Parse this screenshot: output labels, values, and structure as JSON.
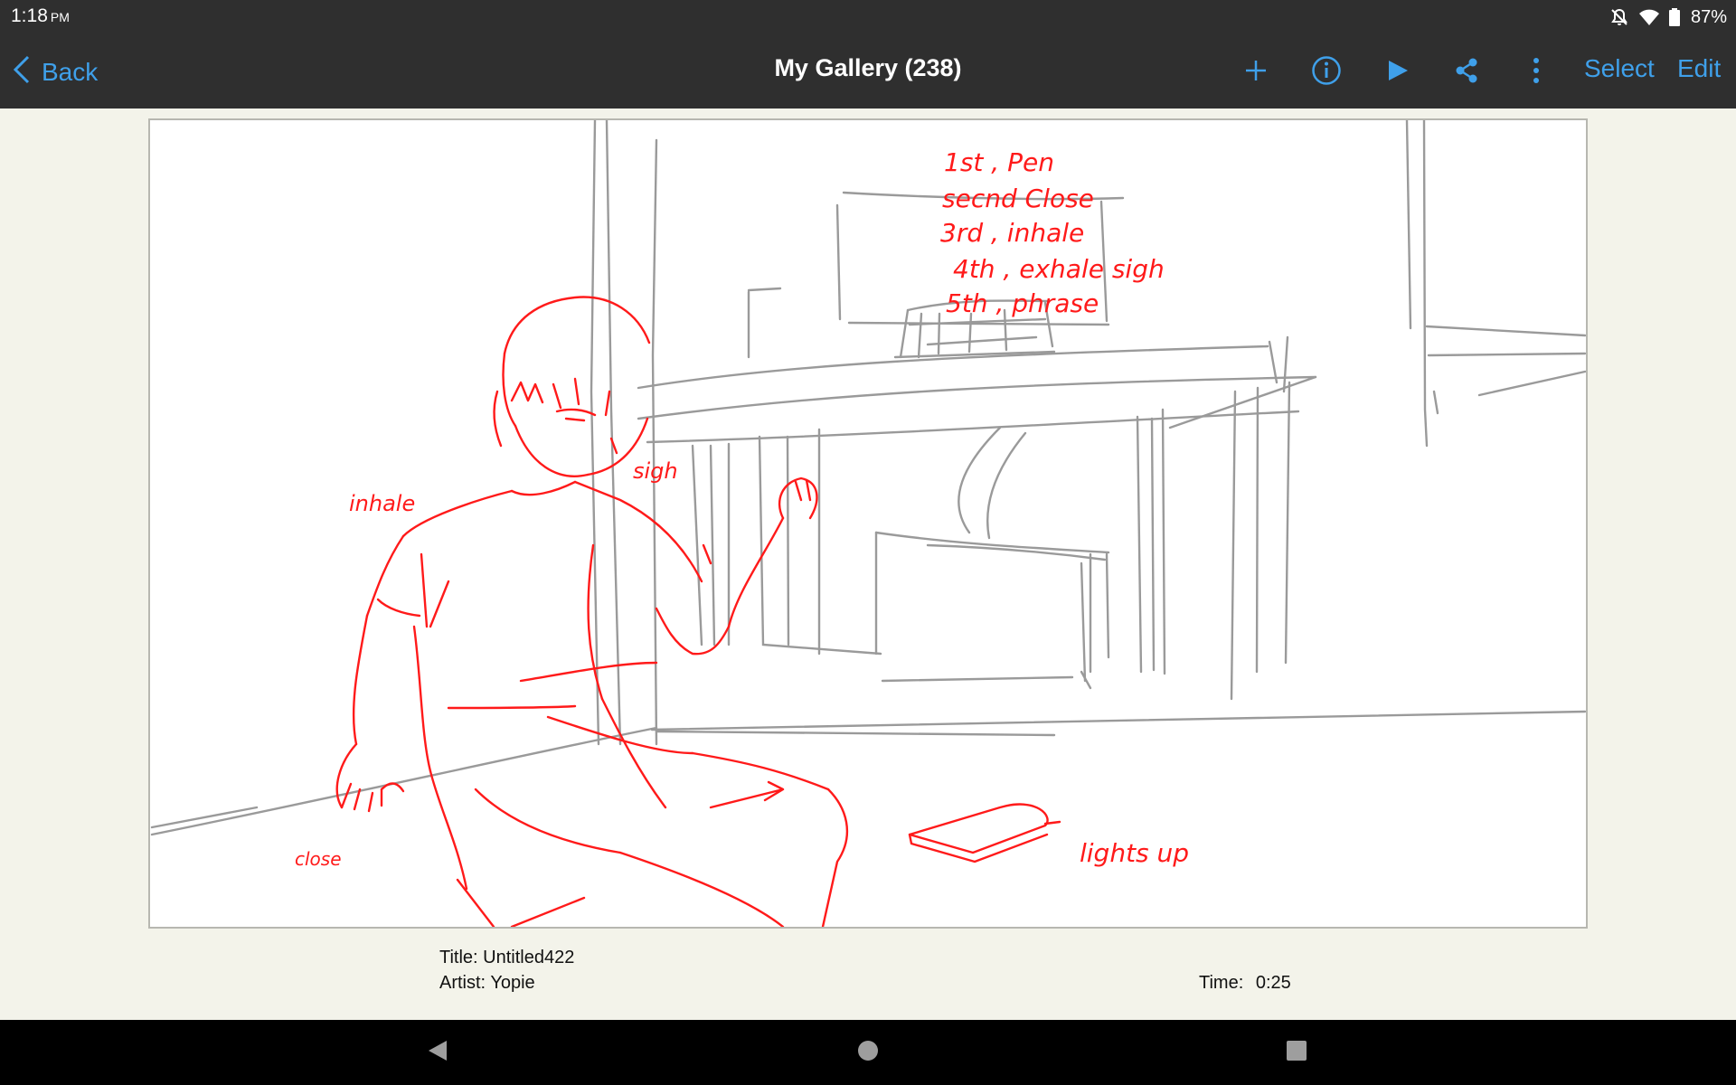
{
  "status": {
    "time": "1:18",
    "ampm": "PM",
    "battery": "87%"
  },
  "toolbar": {
    "back_label": "Back",
    "title": "My Gallery (238)",
    "select_label": "Select",
    "edit_label": "Edit",
    "icons": [
      "add-icon",
      "info-icon",
      "play-icon",
      "share-icon",
      "more-vert-icon"
    ]
  },
  "sketch": {
    "annotations": {
      "line1": "1st , Pen",
      "line2": "secnd Close",
      "line3": "3rd , inhale",
      "line4": "4th , exhale sigh",
      "line5": "5th , phrase",
      "inhale": "inhale",
      "sigh": "sigh",
      "close": "close",
      "lights": "lights up"
    },
    "stroke_colors": {
      "ink": "#ff1a1a",
      "pencil": "#9a9a9a"
    }
  },
  "meta": {
    "title_label": "Title:",
    "title_value": "Untitled422",
    "artist_label": "Artist:",
    "artist_value": "Yopie",
    "time_label": "Time:",
    "time_value": "0:25"
  },
  "colors": {
    "accent": "#3fa0ea",
    "bar": "#2f2f2f",
    "background": "#f3f3ea"
  }
}
